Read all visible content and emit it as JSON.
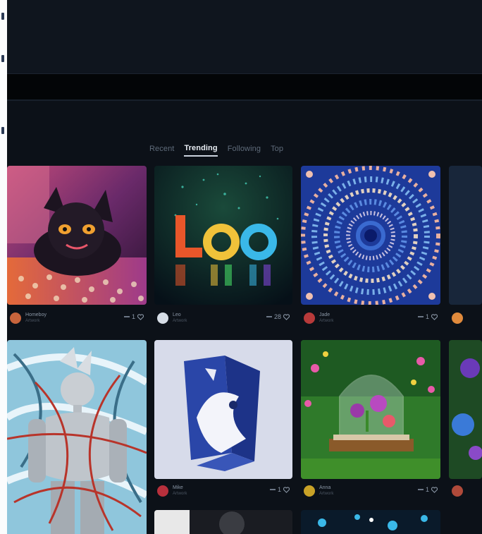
{
  "tabs": [
    {
      "label": "Recent",
      "active": false
    },
    {
      "label": "Trending",
      "active": true
    },
    {
      "label": "Following",
      "active": false
    },
    {
      "label": "Top",
      "active": false
    }
  ],
  "cards": [
    {
      "title": "Black cat on carpet",
      "user": "Homeboy",
      "sub": "Artwork",
      "likes": "1",
      "avatar_color": "#c7643c"
    },
    {
      "title": "Leo neon text",
      "user": "Leo",
      "sub": "Artwork",
      "likes": "28",
      "avatar_color": "#d6dde6"
    },
    {
      "title": "Blue mandala",
      "user": "Jade",
      "sub": "Artwork",
      "likes": "1",
      "avatar_color": "#b73a3a"
    },
    {
      "title": "Partial dark card",
      "user": "",
      "sub": "",
      "likes": "",
      "avatar_color": "#e08a3c"
    },
    {
      "title": "Swirling figure",
      "user": "",
      "sub": "",
      "likes": "",
      "avatar_color": "#9aa6b2"
    },
    {
      "title": "Blue geometric sculpture",
      "user": "Mike",
      "sub": "Artwork",
      "likes": "1",
      "avatar_color": "#b8303c"
    },
    {
      "title": "Glass dome garden",
      "user": "Anna",
      "sub": "Artwork",
      "likes": "1",
      "avatar_color": "#c9a227"
    },
    {
      "title": "Partial flower card",
      "user": "",
      "sub": "",
      "likes": "",
      "avatar_color": "#b04a3a"
    }
  ]
}
